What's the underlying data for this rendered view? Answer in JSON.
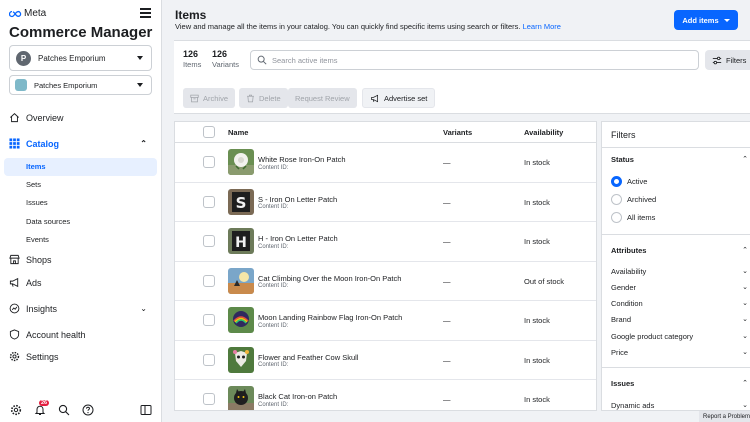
{
  "brand": {
    "logo_text": "Meta",
    "app_title": "Commerce Manager"
  },
  "account": {
    "avatar_letter": "P",
    "name": "Patches Emporium"
  },
  "catalog_selector": {
    "name": "Patches Emporium"
  },
  "nav": {
    "overview": "Overview",
    "catalog": "Catalog",
    "catalog_sub": [
      "Items",
      "Sets",
      "Issues",
      "Data sources",
      "Events"
    ],
    "shops": "Shops",
    "ads": "Ads",
    "insights": "Insights",
    "account_health": "Account health",
    "settings": "Settings"
  },
  "notifications_badge": "26",
  "header": {
    "title": "Items",
    "description": "View and manage all the items in your catalog. You can quickly find specific items using search or filters.",
    "learn_more": "Learn More",
    "add_items": "Add items"
  },
  "counts": {
    "items_value": "126",
    "items_label": "Items",
    "variants_value": "126",
    "variants_label": "Variants"
  },
  "search": {
    "placeholder": "Search active items"
  },
  "filters_button": "Filters",
  "bulk_actions": {
    "archive": "Archive",
    "delete": "Delete",
    "request_review": "Request Review",
    "advertise_set": "Advertise set"
  },
  "table": {
    "headers": {
      "name": "Name",
      "variants": "Variants",
      "availability": "Availability"
    },
    "content_id_label": "Content ID:",
    "rows": [
      {
        "name": "White Rose Iron-On Patch",
        "variants": "—",
        "availability": "In stock"
      },
      {
        "name": "S - Iron On Letter Patch",
        "variants": "—",
        "availability": "In stock"
      },
      {
        "name": "H - Iron On Letter Patch",
        "variants": "—",
        "availability": "In stock"
      },
      {
        "name": "Cat Climbing Over the Moon Iron-On Patch",
        "variants": "—",
        "availability": "Out of stock"
      },
      {
        "name": "Moon Landing Rainbow Flag Iron-On Patch",
        "variants": "—",
        "availability": "In stock"
      },
      {
        "name": "Flower and Feather Cow Skull",
        "variants": "—",
        "availability": "In stock"
      },
      {
        "name": "Black Cat Iron-on Patch",
        "variants": "—",
        "availability": "In stock"
      }
    ]
  },
  "filter_panel": {
    "title": "Filters",
    "status_heading": "Status",
    "status_options": [
      "Active",
      "Archived",
      "All items"
    ],
    "attributes_heading": "Attributes",
    "attributes": [
      "Availability",
      "Gender",
      "Condition",
      "Brand",
      "Google product category",
      "Price"
    ],
    "issues_heading": "Issues",
    "issues": [
      "Dynamic ads"
    ]
  },
  "report_problem": "Report a Problem",
  "colors": {
    "accent": "#0866ff",
    "badge": "#e41e3f"
  }
}
